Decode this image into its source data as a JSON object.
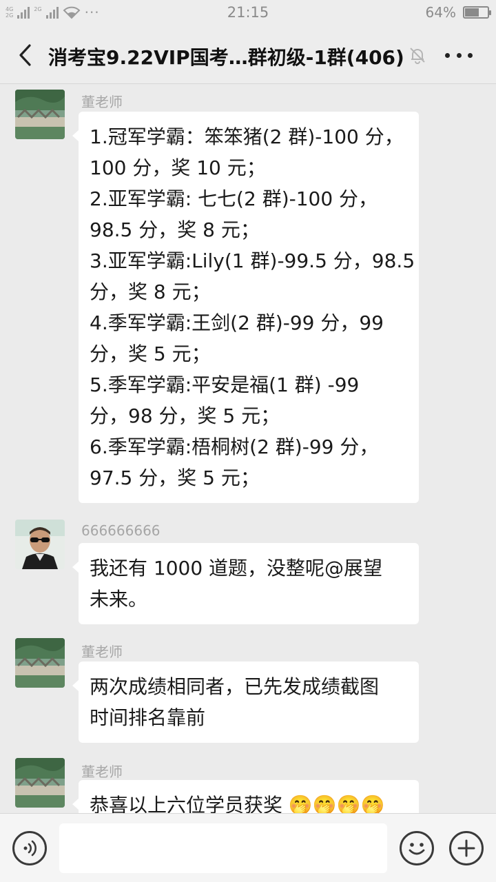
{
  "status_bar": {
    "network_top": "4G",
    "network_bottom": "2G",
    "network_top2": "2G",
    "dots": "···",
    "time": "21:15",
    "battery_text": "64%",
    "battery_level": 0.64
  },
  "header": {
    "title": "消考宝9.22VIP国考…群初级-1群(406)",
    "back_icon": "chevron-left-icon",
    "mute_icon": "bell-off-icon",
    "more_icon": "more-dots-icon"
  },
  "messages": [
    {
      "sender": "董老师",
      "avatar": "landscape-avatar",
      "lines": [
        "1.冠军学霸：笨笨猪(2 群)-100 分，",
        "100 分，奖 10 元；",
        "2.亚军学霸: 七七(2 群)-100 分，",
        "98.5 分，奖 8 元；",
        "3.亚军学霸:Lily(1 群)-99.5 分，98.5",
        "分，奖 8 元；",
        "4.季军学霸:王剑(2 群)-99 分，99",
        "分，奖 5 元；",
        "5.季军学霸:平安是福(1 群) -99",
        "分，98 分，奖 5 元；",
        "6.季军学霸:梧桐树(2 群)-99 分，",
        "97.5 分，奖 5 元；"
      ]
    },
    {
      "sender": "666666666",
      "avatar": "man-sunglasses-avatar",
      "lines": [
        "我还有 1000 道题，没整呢@展望",
        "未来。"
      ]
    },
    {
      "sender": "董老师",
      "avatar": "landscape-avatar",
      "lines": [
        "两次成绩相同者，已先发成绩截图",
        "时间排名靠前"
      ]
    },
    {
      "sender": "董老师",
      "avatar": "landscape-avatar",
      "lines": [
        "恭喜以上六位学员获奖 🤭🤭🤭🤭"
      ]
    }
  ],
  "input_bar": {
    "voice_icon": "voice-icon",
    "emoji_icon": "emoji-icon",
    "plus_icon": "plus-icon",
    "input_value": ""
  }
}
